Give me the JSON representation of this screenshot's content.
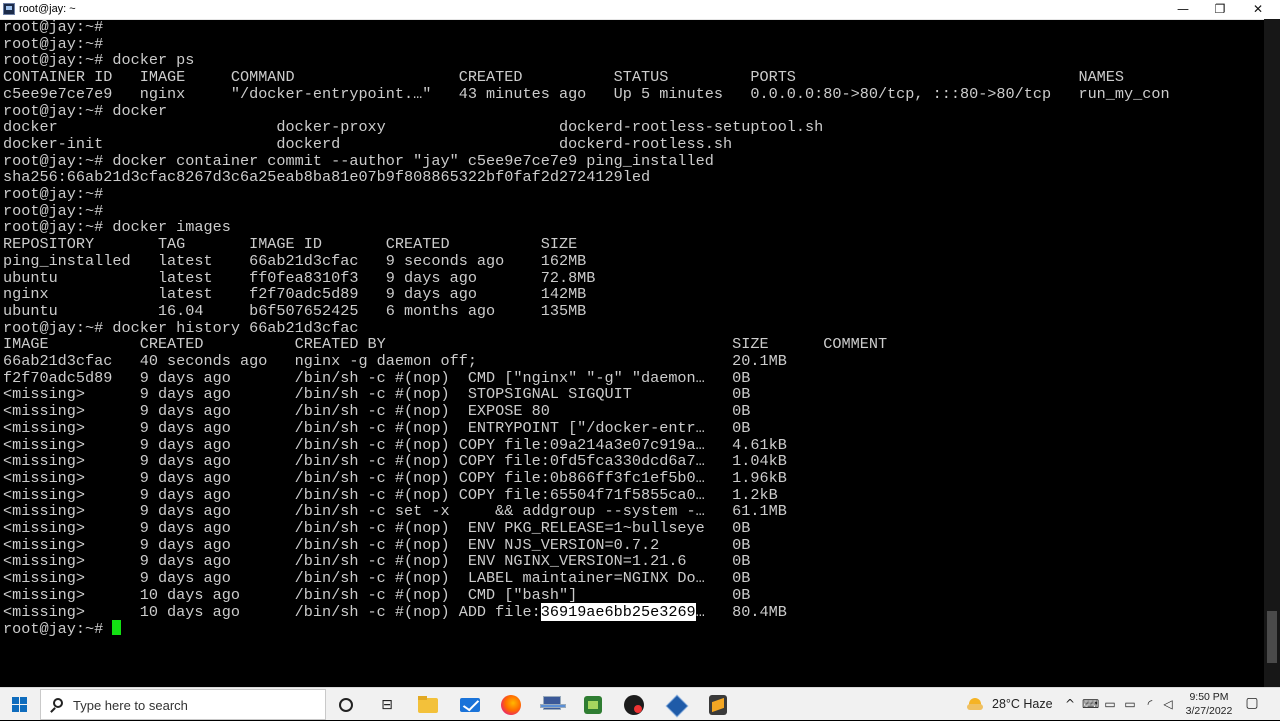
{
  "window": {
    "title": "root@jay: ~",
    "minimize": "—",
    "maximize": "❐",
    "close": "✕"
  },
  "terminal": {
    "lines": [
      "root@jay:~#",
      "root@jay:~#",
      "root@jay:~# docker ps",
      "CONTAINER ID   IMAGE     COMMAND                  CREATED          STATUS         PORTS                               NAMES",
      "c5ee9e7ce7e9   nginx     \"/docker-entrypoint.…\"   43 minutes ago   Up 5 minutes   0.0.0.0:80->80/tcp, :::80->80/tcp   run_my_con",
      "root@jay:~# docker",
      "docker                        docker-proxy                   dockerd-rootless-setuptool.sh",
      "docker-init                   dockerd                        dockerd-rootless.sh",
      "root@jay:~# docker container commit --author \"jay\" c5ee9e7ce7e9 ping_installed",
      "sha256:66ab21d3cfac8267d3c6a25eab8ba81e07b9f808865322bf0faf2d2724129led",
      "root@jay:~#",
      "root@jay:~#",
      "root@jay:~# docker images",
      "REPOSITORY       TAG       IMAGE ID       CREATED          SIZE",
      "ping_installed   latest    66ab21d3cfac   9 seconds ago    162MB",
      "ubuntu           latest    ff0fea8310f3   9 days ago       72.8MB",
      "nginx            latest    f2f70adc5d89   9 days ago       142MB",
      "ubuntu           16.04     b6f507652425   6 months ago     135MB",
      "root@jay:~# docker history 66ab21d3cfac",
      "IMAGE          CREATED          CREATED BY                                      SIZE      COMMENT",
      "66ab21d3cfac   40 seconds ago   nginx -g daemon off;                            20.1MB",
      "f2f70adc5d89   9 days ago       /bin/sh -c #(nop)  CMD [\"nginx\" \"-g\" \"daemon…   0B",
      "<missing>      9 days ago       /bin/sh -c #(nop)  STOPSIGNAL SIGQUIT           0B",
      "<missing>      9 days ago       /bin/sh -c #(nop)  EXPOSE 80                    0B",
      "<missing>      9 days ago       /bin/sh -c #(nop)  ENTRYPOINT [\"/docker-entr…   0B",
      "<missing>      9 days ago       /bin/sh -c #(nop) COPY file:09a214a3e07c919a…   4.61kB",
      "<missing>      9 days ago       /bin/sh -c #(nop) COPY file:0fd5fca330dcd6a7…   1.04kB",
      "<missing>      9 days ago       /bin/sh -c #(nop) COPY file:0b866ff3fc1ef5b0…   1.96kB",
      "<missing>      9 days ago       /bin/sh -c #(nop) COPY file:65504f71f5855ca0…   1.2kB",
      "<missing>      9 days ago       /bin/sh -c set -x     && addgroup --system -…   61.1MB",
      "<missing>      9 days ago       /bin/sh -c #(nop)  ENV PKG_RELEASE=1~bullseye   0B",
      "<missing>      9 days ago       /bin/sh -c #(nop)  ENV NJS_VERSION=0.7.2        0B",
      "<missing>      9 days ago       /bin/sh -c #(nop)  ENV NGINX_VERSION=1.21.6     0B",
      "<missing>      9 days ago       /bin/sh -c #(nop)  LABEL maintainer=NGINX Do…   0B",
      "<missing>      10 days ago      /bin/sh -c #(nop)  CMD [\"bash\"]                 0B"
    ],
    "last_history": {
      "prefix": "<missing>      10 days ago      /bin/sh -c #(nop) ADD file:",
      "selected": "36919ae6bb25e3269",
      "suffix": "…   80.4MB"
    },
    "prompt": "root@jay:~# "
  },
  "taskbar": {
    "search_placeholder": "Type here to search",
    "task_view_glyph": "⊟",
    "weather": "28°C  Haze",
    "tray_glyphs": {
      "chevron": "^",
      "battery": "▭",
      "network": "◜",
      "volume": "◁",
      "input": "⌨"
    },
    "time": "9:50 PM",
    "date": "3/27/2022",
    "notification_glyph": "▢"
  },
  "colors": {
    "terminal_bg": "#000000",
    "terminal_fg": "#cccccc",
    "cursor": "#13e013",
    "taskbar_bg": "#f1f1f1"
  }
}
